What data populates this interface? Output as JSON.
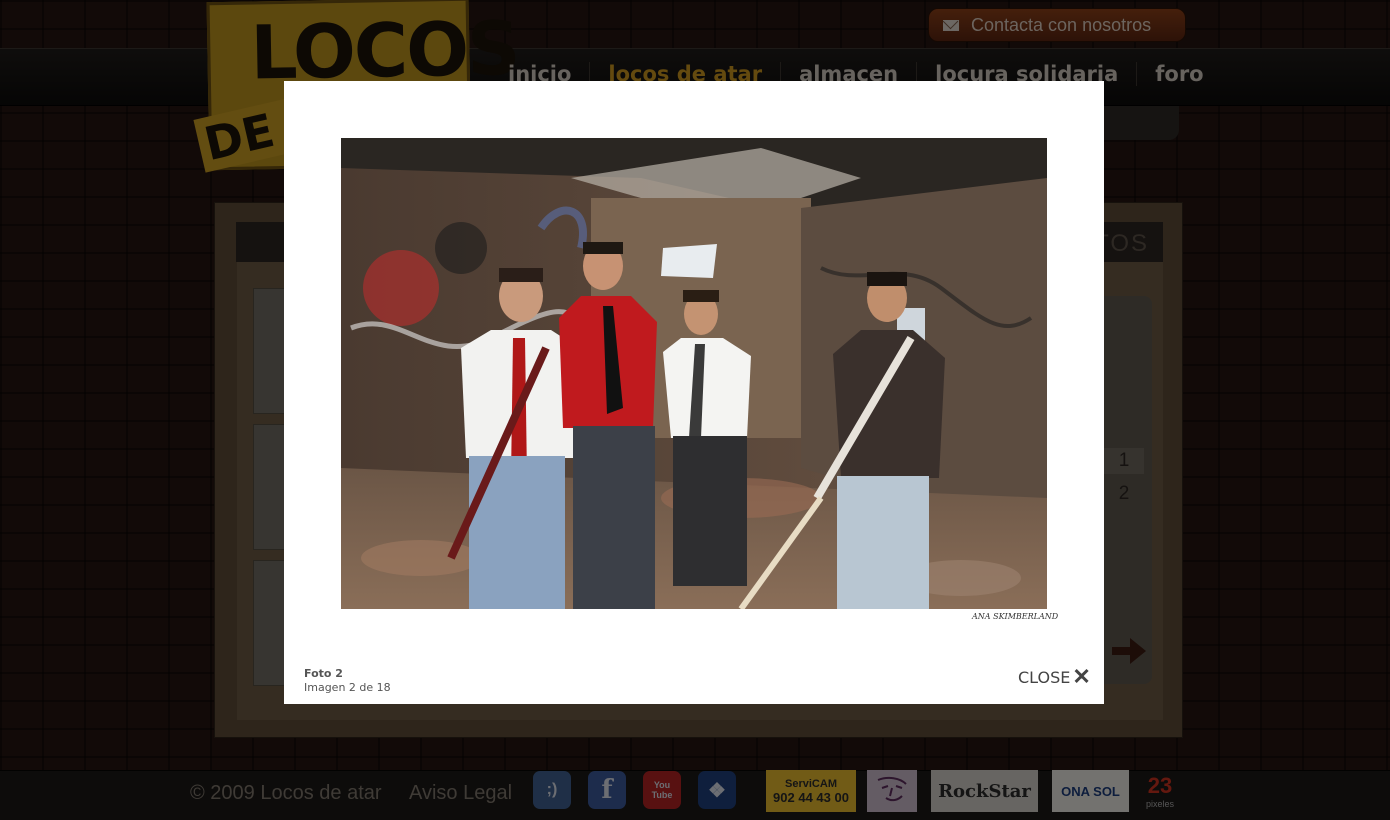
{
  "site": {
    "logo_top": "LOCOS",
    "logo_bottom": "DE A",
    "contact_label": "Contacta con nosotros",
    "nav": [
      {
        "label": "inicio"
      },
      {
        "label": "locos de atar"
      },
      {
        "label": "almacen"
      },
      {
        "label": "locura solidaria"
      },
      {
        "label": "foro"
      }
    ],
    "section_title_partial": "TOS",
    "pages": [
      "1",
      "2"
    ]
  },
  "footer": {
    "copyright": "© 2009  Locos de atar",
    "legal": "Aviso Legal",
    "social": [
      {
        "icon": "tuenti-icon",
        "glyph": ";)",
        "color": "#3e5f8e"
      },
      {
        "icon": "facebook-icon",
        "glyph": "f",
        "color": "#3b5998"
      },
      {
        "icon": "youtube-icon",
        "glyph": "You Tube",
        "color": "#b12323"
      },
      {
        "icon": "myspace-icon",
        "glyph": "❖",
        "color": "#1e3f7a"
      }
    ],
    "sponsors": [
      {
        "name": "ServiCAM",
        "line2": "902 44 43 00"
      },
      {
        "name": "logo"
      },
      {
        "name": "RockStar"
      },
      {
        "name": "ONA SOL"
      },
      {
        "name": "23",
        "line2": "pixeles"
      }
    ]
  },
  "lightbox": {
    "photo_credit": "ANA SKIMBERLAND",
    "caption_title": "Foto 2",
    "caption_count": "Imagen 2 de 18",
    "close_label": "CLOSE",
    "close_glyph": "✕"
  },
  "colors": {
    "accent": "#c8951e",
    "overlay": "rgba(0,0,0,0.5)",
    "lightbox_bg": "#ffffff"
  }
}
